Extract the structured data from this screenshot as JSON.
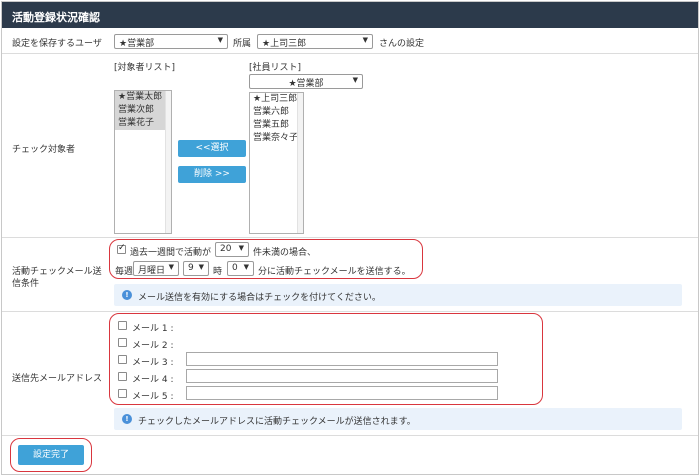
{
  "title": "活動登録状況確認",
  "save_user": {
    "label": "設定を保存するユーザ",
    "dept_value": "★営業部",
    "affil_label": "所属",
    "user_value": "★上司三郎",
    "suffix": "さんの設定"
  },
  "check_target": {
    "label": "チェック対象者",
    "target_list_label": "[対象者リスト]",
    "target_list": [
      "★営業太郎",
      "営業次郎",
      "営業花子"
    ],
    "employee_list_label": "[社員リスト]",
    "employee_dept_value": "★営業部",
    "employee_list": [
      "★上司三郎",
      "営業六郎",
      "営業五郎",
      "営業奈々子"
    ],
    "select_button": "<<選択",
    "delete_button": "削除 >>"
  },
  "condition": {
    "label_line1": "活動チェックメール送",
    "label_line2": "信条件",
    "checkbox_checked": true,
    "text_before_count": "過去一週間で活動が",
    "count_value": "20",
    "text_after_count": "件未満の場合、",
    "weekly_label": "毎週",
    "weekday_value": "月曜日",
    "hour_value": "9",
    "hour_label": "時",
    "minute_value": "0",
    "minute_label": "分に活動チェックメールを送信する。",
    "info": "メール送信を有効にする場合はチェックを付けてください。"
  },
  "emails": {
    "label": "送信先メールアドレス",
    "items": [
      {
        "label": "メール 1 :",
        "checked": false
      },
      {
        "label": "メール 2 :",
        "checked": false
      },
      {
        "label": "メール 3 :",
        "checked": false
      },
      {
        "label": "メール 4 :",
        "checked": false
      },
      {
        "label": "メール 5 :",
        "checked": false
      }
    ],
    "info": "チェックしたメールアドレスに活動チェックメールが送信されます。"
  },
  "complete_button": "設定完了",
  "colors": {
    "titlebar": "#2c3a4b",
    "button": "#3fa2d8",
    "highlight": "#d9363e",
    "info_bg": "#eaf2fb"
  }
}
